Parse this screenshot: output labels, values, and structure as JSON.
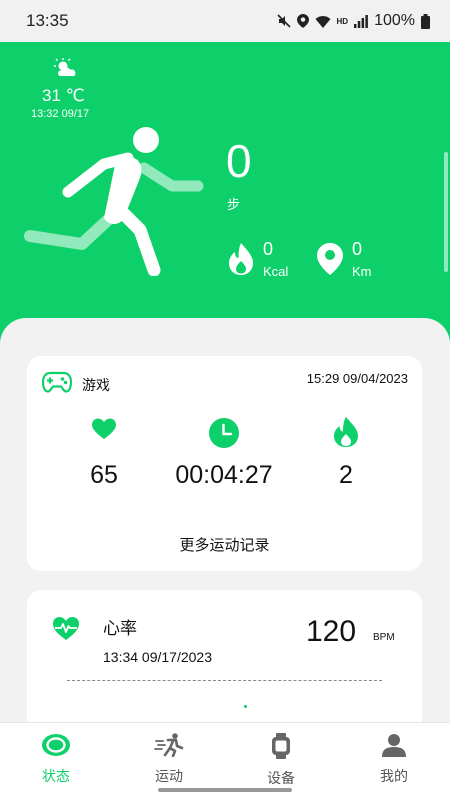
{
  "status_bar": {
    "time": "13:35",
    "battery": "100%",
    "network": "HD"
  },
  "weather": {
    "temp": "31 ℃",
    "time": "13:32 09/17",
    "icon": "partly-cloudy-icon"
  },
  "activity": {
    "steps_value": "0",
    "steps_unit": "步",
    "calories_value": "0",
    "calories_unit": "Kcal",
    "distance_value": "0",
    "distance_unit": "Km"
  },
  "workout_card": {
    "type_label": "游戏",
    "datetime": "15:29 09/04/2023",
    "heart_rate": "65",
    "duration": "00:04:27",
    "calories": "2",
    "more_link": "更多运动记录"
  },
  "heart_rate_card": {
    "label": "心率",
    "datetime": "13:34 09/17/2023",
    "value": "120",
    "unit": "BPM"
  },
  "tabs": [
    {
      "label": "状态",
      "icon": "status-ring-icon",
      "active": true
    },
    {
      "label": "运动",
      "icon": "running-icon",
      "active": false
    },
    {
      "label": "设备",
      "icon": "watch-icon",
      "active": false
    },
    {
      "label": "我的",
      "icon": "person-icon",
      "active": false
    }
  ],
  "colors": {
    "accent": "#0ed06a",
    "background": "#f2f2f2",
    "card": "#ffffff"
  }
}
